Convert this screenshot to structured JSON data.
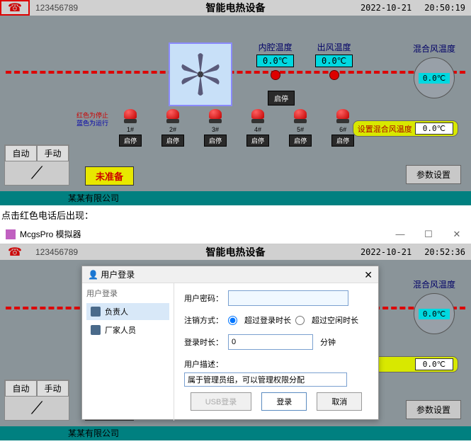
{
  "top": {
    "phone": "123456789",
    "title": "智能电热设备",
    "date": "2022-10-21",
    "time1": "20:50:19",
    "time2": "20:52:36"
  },
  "temps": {
    "inner_label": "内腔温度",
    "inner_val": "0.0℃",
    "out_label": "出风温度",
    "out_val": "0.0℃",
    "mix_label": "混合风温度",
    "mix_val": "0.0℃"
  },
  "status": {
    "red_line": "红色为停止",
    "blue_line": "蓝色为运行"
  },
  "lights": [
    "1#",
    "2#",
    "3#",
    "4#",
    "5#",
    "6#"
  ],
  "btns": {
    "startstop": "启停",
    "set_mix_label": "设置混合风温度",
    "set_mix_val": "0.0℃",
    "auto": "自动",
    "manual": "手动",
    "not_ready": "未准备",
    "params": "参数设置"
  },
  "footer": {
    "company": "某某有限公司"
  },
  "caption": "点击红色电话后出现：",
  "sim": {
    "title": "McgsPro 模拟器"
  },
  "login": {
    "dlg_icon": "👤",
    "dlg_title": "用户登录",
    "section": "用户登录",
    "users": [
      "负责人",
      "厂家人员"
    ],
    "pwd_label": "用户密码：",
    "logout_label": "注销方式：",
    "opt1": "超过登录时长",
    "opt2": "超过空闲时长",
    "duration_label": "登录时长：",
    "duration_val": "0",
    "duration_unit": "分钟",
    "desc_label": "用户描述：",
    "desc_val": "属于管理员组，可以管理权限分配",
    "btn_usb": "USB登录",
    "btn_login": "登录",
    "btn_cancel": "取消"
  }
}
